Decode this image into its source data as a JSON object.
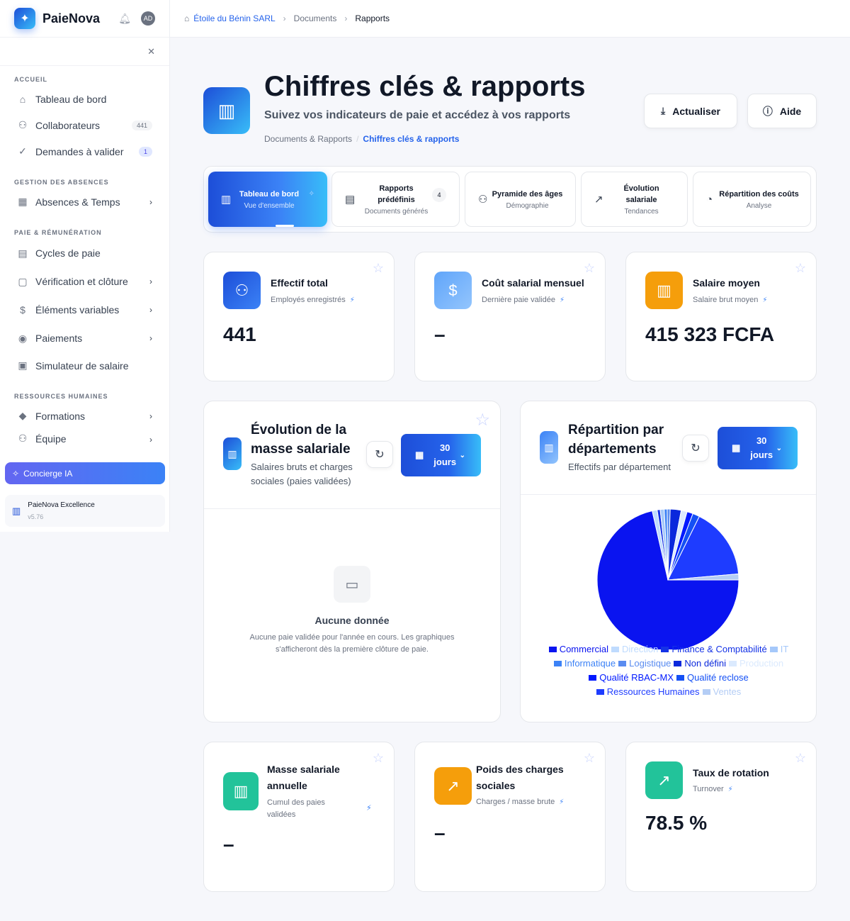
{
  "app": {
    "name": "PaieNova",
    "avatar": "AD"
  },
  "sidebar": {
    "sections": [
      {
        "title": "ACCUEIL"
      },
      {
        "title": "GESTION DES ABSENCES"
      },
      {
        "title": "PAIE & RÉMUNÉRATION"
      },
      {
        "title": "RESSOURCES HUMAINES"
      }
    ],
    "items": [
      {
        "label": "Tableau de bord",
        "icon": "home-icon"
      },
      {
        "label": "Collaborateurs",
        "icon": "users-icon",
        "count": "441"
      },
      {
        "label": "Demandes à valider",
        "icon": "check-circle-icon",
        "count": "1"
      },
      {
        "label": "Absences & Temps",
        "icon": "calendar-icon"
      },
      {
        "label": "Cycles de paie",
        "icon": "calendar-clock-icon"
      },
      {
        "label": "Vérification et clôture",
        "icon": "file-check-icon"
      },
      {
        "label": "Éléments variables",
        "icon": "dollar-icon"
      },
      {
        "label": "Paiements",
        "icon": "coin-icon"
      },
      {
        "label": "Simulateur de salaire",
        "icon": "calculator-icon"
      },
      {
        "label": "Formations",
        "icon": "graduation-icon"
      },
      {
        "label": "Équipe",
        "icon": "user-plus-icon"
      }
    ],
    "concierge": "Concierge IA",
    "version_name": "PaieNova Excellence",
    "version": "v5.76"
  },
  "breadcrumb": {
    "company": "Étoile du Bénin SARL",
    "section": "Documents",
    "page": "Rapports"
  },
  "hero": {
    "title": "Chiffres clés & rapports",
    "subtitle": "Suivez vos indicateurs de paie et accédez à vos rapports",
    "crumb_parent": "Documents & Rapports",
    "crumb_current": "Chiffres clés & rapports",
    "refresh_label": "Actualiser",
    "help_label": "Aide"
  },
  "tabs": [
    {
      "label": "Tableau de bord",
      "sub": "Vue d'ensemble"
    },
    {
      "label": "Rapports prédéfinis",
      "sub": "Documents générés",
      "badge": "4"
    },
    {
      "label": "Pyramide des âges",
      "sub": "Démographie"
    },
    {
      "label": "Évolution salariale",
      "sub": "Tendances"
    },
    {
      "label": "Répartition des coûts",
      "sub": "Analyse"
    }
  ],
  "kpis": [
    {
      "title": "Effectif total",
      "sub": "Employés enregistrés",
      "value": "441",
      "color": "#2563eb"
    },
    {
      "title": "Coût salarial mensuel",
      "sub": "Dernière paie validée",
      "value": "–",
      "color": "#60a5fa"
    },
    {
      "title": "Salaire moyen",
      "sub": "Salaire brut moyen",
      "value": "415 323 FCFA",
      "color": "#f59e0b"
    }
  ],
  "payroll_panel": {
    "title_line1": "Évolution de la",
    "title_line2": "masse salariale",
    "sub_line1": "Salaires bruts et charges",
    "sub_line2": "sociales (paies validées)",
    "period_line1": "30",
    "period_line2": "jours",
    "empty_title": "Aucune donnée",
    "empty_text": "Aucune paie validée pour l'année en cours. Les graphiques s'afficheront dès la première clôture de paie."
  },
  "dept_panel": {
    "title_line1": "Répartition par",
    "title_line2": "départements",
    "sub": "Effectifs par département",
    "period_line1": "30",
    "period_line2": "jours"
  },
  "chart_data": {
    "type": "pie",
    "categories": [
      "Commercial",
      "Direction",
      "Finance & Comptabilité",
      "IT",
      "Informatique",
      "Logistique",
      "Non défini",
      "Production",
      "Qualité RBAC-MX",
      "Qualité reclose",
      "Ressources Humaines",
      "Ventes"
    ],
    "values": [
      315,
      5,
      3,
      4,
      3,
      3,
      11,
      6,
      6,
      7,
      72,
      6
    ],
    "colors": [
      "#0a14f0",
      "#bfdbfe",
      "#1432e6",
      "#a5c8fa",
      "#3c82f6",
      "#5a8cf0",
      "#0a28dc",
      "#dbeafe",
      "#0019ff",
      "#1450f5",
      "#1e3cff",
      "#b4cdf5"
    ],
    "legend_position": "bottom"
  },
  "kpis2": [
    {
      "title_line1": "Masse salariale",
      "title_line2": "annuelle",
      "sub_line1": "Cumul des paies",
      "sub_line2": "validées",
      "value": "–",
      "color": "#22c39a"
    },
    {
      "title_line1": "Poids des charges",
      "title_line2": "sociales",
      "sub": "Charges / masse brute",
      "value": "–",
      "color": "#f59e0b"
    },
    {
      "title": "Taux de rotation",
      "sub": "Turnover",
      "value": "78.5 %",
      "color": "#22c39a"
    }
  ]
}
